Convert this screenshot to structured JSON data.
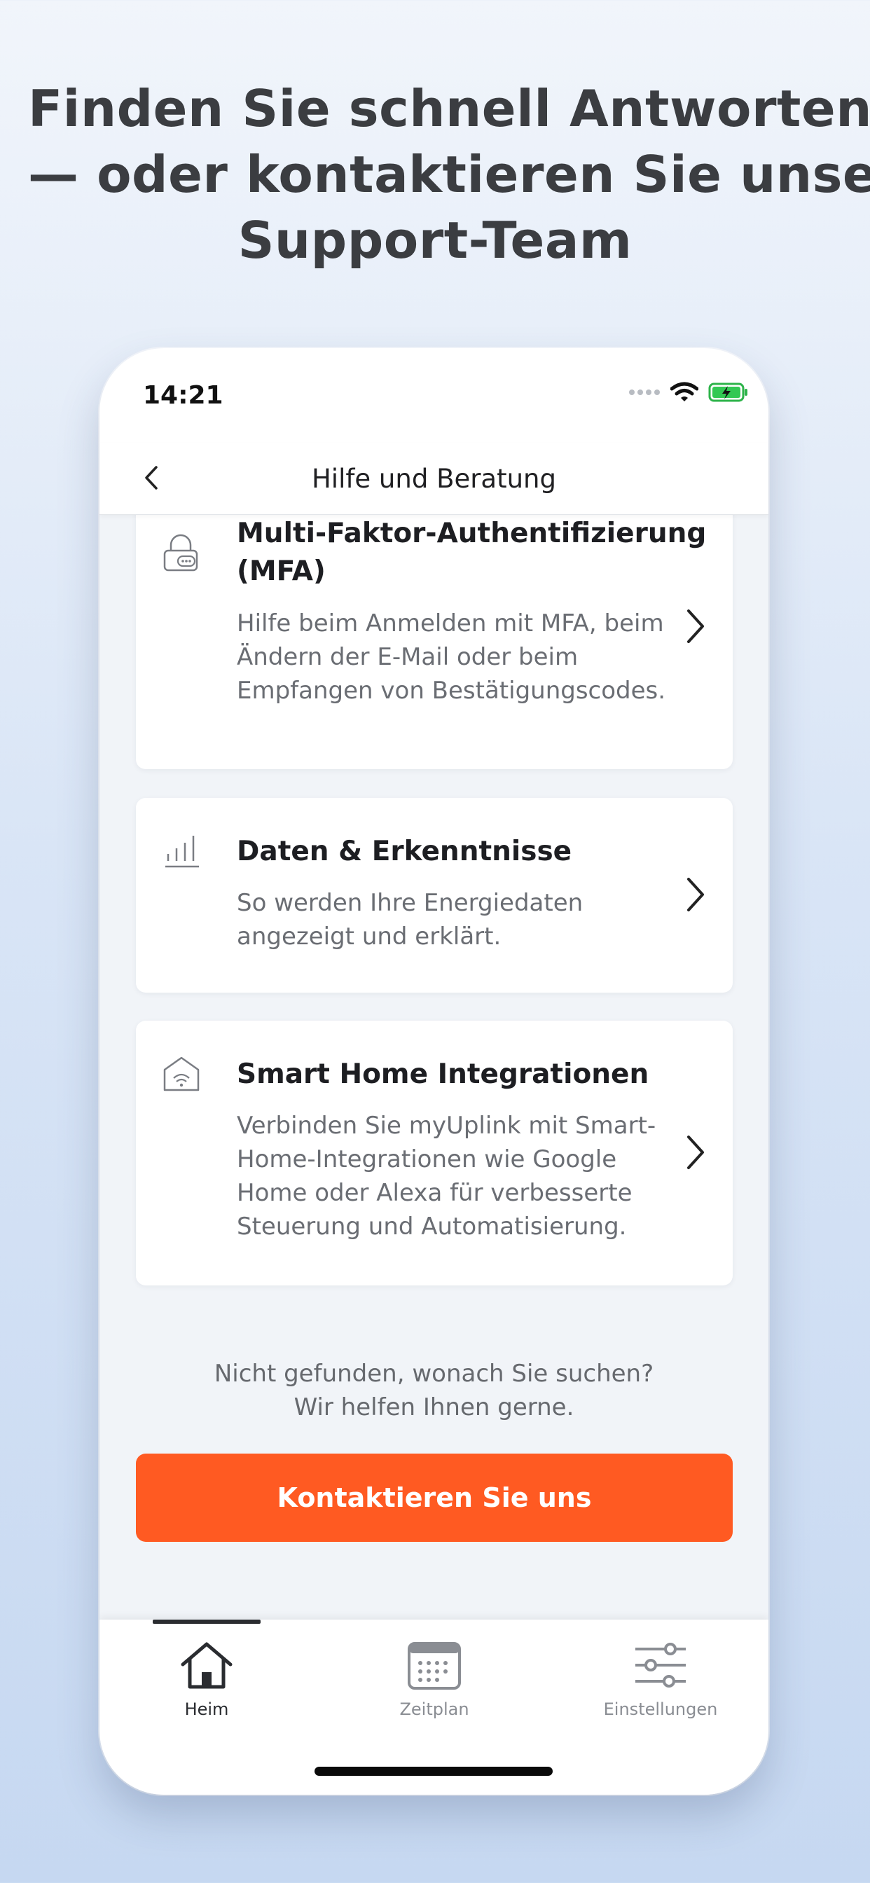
{
  "headline": {
    "line1": "Finden Sie schnell Antworten",
    "line2": "— oder kontaktieren Sie unser",
    "line3": "Support-Team"
  },
  "status_bar": {
    "time": "14:21"
  },
  "nav": {
    "title": "Hilfe und Beratung"
  },
  "cards": [
    {
      "icon": "lock-icon",
      "title_line1": "Multi-Faktor-Authentifizierung",
      "title_line2": "(MFA)",
      "desc_lines": [
        "Hilfe beim Anmelden mit MFA, beim",
        "Ändern der E-Mail oder beim",
        "Empfangen von Bestätigungscodes."
      ]
    },
    {
      "icon": "bar-chart-icon",
      "title": "Daten & Erkenntnisse",
      "desc_lines": [
        "So werden Ihre Energiedaten",
        "angezeigt und erklärt."
      ]
    },
    {
      "icon": "smart-home-icon",
      "title": "Smart Home Integrationen",
      "desc_lines": [
        "Verbinden Sie myUplink mit Smart-",
        "Home-Integrationen wie Google",
        "Home oder Alexa für verbesserte",
        "Steuerung und Automatisierung."
      ]
    }
  ],
  "help": {
    "line1": "Nicht gefunden, wonach Sie suchen?",
    "line2": "Wir helfen Ihnen gerne."
  },
  "cta_label": "Kontaktieren Sie uns",
  "tabs": [
    {
      "label": "Heim",
      "icon": "home-icon",
      "active": true
    },
    {
      "label": "Zeitplan",
      "icon": "calendar-icon",
      "active": false
    },
    {
      "label": "Einstellungen",
      "icon": "sliders-icon",
      "active": false
    }
  ],
  "colors": {
    "accent": "#ff5a22",
    "text": "#1d1e22",
    "muted": "#6a6d73"
  }
}
